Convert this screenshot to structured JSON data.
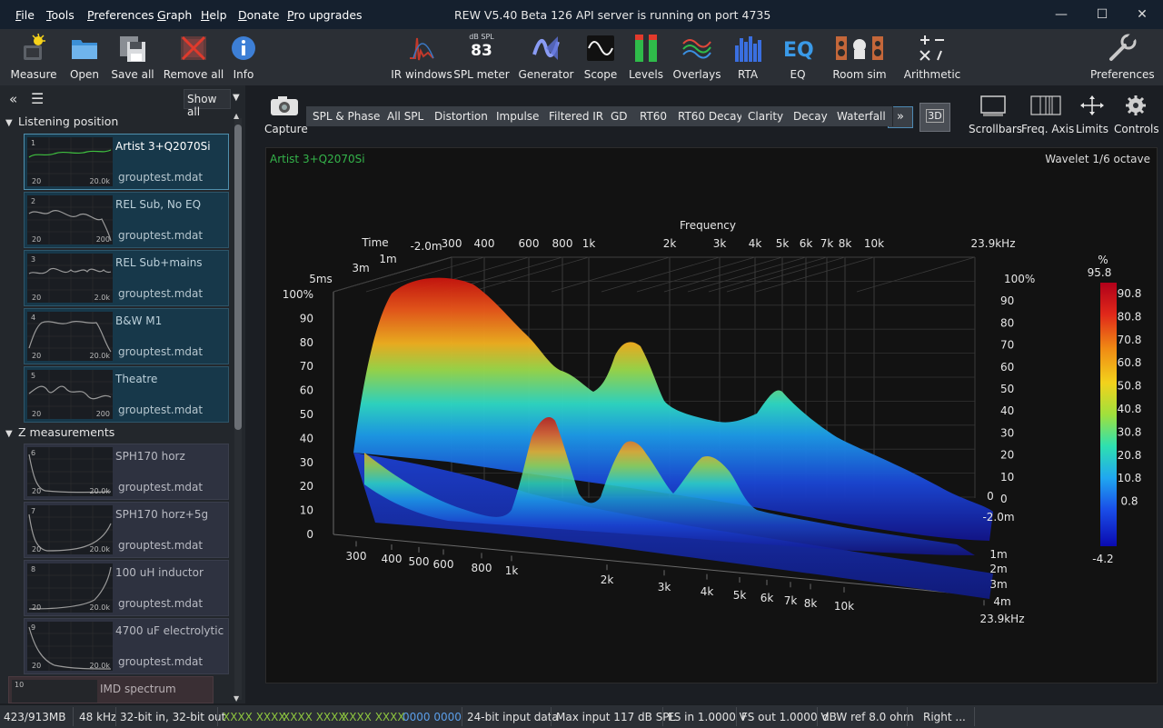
{
  "menu": [
    "File",
    "Tools",
    "Preferences",
    "Graph",
    "Help",
    "Donate",
    "Pro upgrades"
  ],
  "app_title": "REW V5.40 Beta 126 API server is running on port 4735",
  "toolbar_left": [
    "Measure",
    "Open",
    "Save all",
    "Remove all",
    "Info"
  ],
  "toolbar_center": [
    "IR windows",
    "SPL meter",
    "Generator",
    "Scope",
    "Levels",
    "Overlays",
    "RTA",
    "EQ",
    "Room sim",
    "Arithmetic"
  ],
  "spl_meter": {
    "unit": "dB SPL",
    "value": "83"
  },
  "toolbar_right": [
    "Preferences"
  ],
  "panel": {
    "show_all": "Show all",
    "groups": [
      {
        "title": "Listening position",
        "items": [
          {
            "num": "1",
            "name": "Artist 3+Q2070Si",
            "file": "grouptest.mdat",
            "xmin": "20",
            "xmax": "20.0k"
          },
          {
            "num": "2",
            "name": "REL Sub, No EQ",
            "file": "grouptest.mdat",
            "xmin": "20",
            "xmax": "200"
          },
          {
            "num": "3",
            "name": "REL Sub+mains",
            "file": "grouptest.mdat",
            "xmin": "20",
            "xmax": "2.0k"
          },
          {
            "num": "4",
            "name": "B&W M1",
            "file": "grouptest.mdat",
            "xmin": "20",
            "xmax": "20.0k"
          },
          {
            "num": "5",
            "name": "Theatre",
            "file": "grouptest.mdat",
            "xmin": "20",
            "xmax": "200"
          }
        ]
      },
      {
        "title": "Z measurements",
        "items": [
          {
            "num": "6",
            "name": "SPH170 horz",
            "file": "grouptest.mdat",
            "xmin": "20",
            "xmax": "20.0k"
          },
          {
            "num": "7",
            "name": "SPH170 horz+5g",
            "file": "grouptest.mdat",
            "xmin": "20",
            "xmax": "20.0k"
          },
          {
            "num": "8",
            "name": "100 uH inductor",
            "file": "grouptest.mdat",
            "xmin": "20",
            "xmax": "20.0k"
          },
          {
            "num": "9",
            "name": "4700 uF electrolytic",
            "file": "grouptest.mdat",
            "xmin": "20",
            "xmax": "20.0k"
          }
        ]
      }
    ],
    "partial_item": {
      "num": "10",
      "name": "IMD spectrum"
    }
  },
  "capture_label": "Capture",
  "graph_tabs": [
    "SPL & Phase",
    "All SPL",
    "Distortion",
    "Impulse",
    "Filtered IR",
    "GD",
    "RT60",
    "RT60 Decay",
    "Clarity",
    "Decay",
    "Waterfall"
  ],
  "toggle_3d": "3D",
  "right_tools": [
    "Scrollbars",
    "Freq. Axis",
    "Limits",
    "Controls"
  ],
  "graph": {
    "measurement_label": "Artist 3+Q2070Si",
    "mode_label": "Wavelet 1/6 octave",
    "freq_title": "Frequency",
    "time_title": "Time",
    "top_freq_ticks": [
      "300",
      "400",
      "600",
      "800",
      "1k",
      "2k",
      "3k",
      "4k",
      "5k",
      "6k",
      "7k",
      "8k",
      "10k",
      "23.9kHz"
    ],
    "bottom_freq_ticks": [
      "300",
      "400",
      "500",
      "600",
      "800",
      "1k",
      "2k",
      "3k",
      "4k",
      "5k",
      "6k",
      "7k",
      "8k",
      "10k",
      "23.9kHz"
    ],
    "left_time_ticks": [
      "-2.0m",
      "1m",
      "3m",
      "5ms"
    ],
    "right_time_ticks": [
      "-2.0m",
      "0",
      "1m",
      "2m",
      "3m",
      "4m"
    ],
    "left_level_ticks": [
      "100%",
      "90",
      "80",
      "70",
      "60",
      "50",
      "40",
      "30",
      "20",
      "10",
      "0"
    ],
    "right_level_ticks": [
      "100%",
      "90",
      "80",
      "70",
      "60",
      "50",
      "40",
      "30",
      "20",
      "10",
      "0"
    ],
    "colorbar": {
      "unit": "%",
      "max": "95.8",
      "ticks": [
        "90.8",
        "80.8",
        "70.8",
        "60.8",
        "50.8",
        "40.8",
        "30.8",
        "20.8",
        "10.8",
        "0.8"
      ],
      "min": "-4.2"
    }
  },
  "status": [
    "423/913MB",
    "48 kHz",
    "32-bit in, 32-bit out",
    "XXXX XXXX",
    "XXXX XXXX",
    "XXXX XXXX",
    "0000 0000",
    "24-bit input data",
    "Max input 117 dB SPL",
    "FS in 1.0000 V",
    "FS out 1.0000 V",
    "dBW ref 8.0 ohm",
    "Right ..."
  ]
}
